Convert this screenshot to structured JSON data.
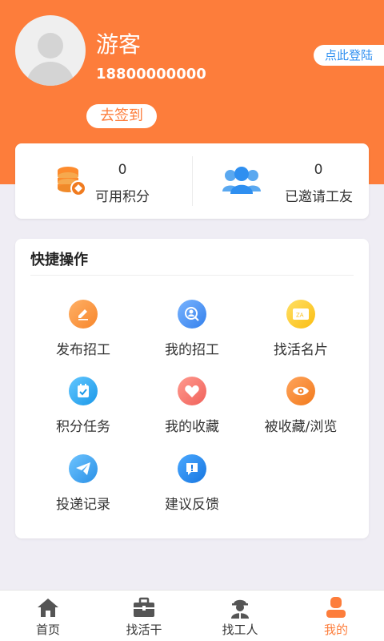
{
  "profile": {
    "username": "游客",
    "phone": "18800000000",
    "login_label": "点此登陆",
    "signin_label": "去签到"
  },
  "stats": [
    {
      "value": "0",
      "label": "可用积分",
      "icon": "coins-icon"
    },
    {
      "value": "0",
      "label": "已邀请工友",
      "icon": "users-icon"
    }
  ],
  "quick": {
    "title": "快捷操作",
    "items": [
      {
        "label": "发布招工",
        "icon": "edit-icon"
      },
      {
        "label": "我的招工",
        "icon": "user-search-icon"
      },
      {
        "label": "找活名片",
        "icon": "card-icon"
      },
      {
        "label": "积分任务",
        "icon": "task-icon"
      },
      {
        "label": "我的收藏",
        "icon": "heart-icon"
      },
      {
        "label": "被收藏/浏览",
        "icon": "eye-icon"
      },
      {
        "label": "投递记录",
        "icon": "send-icon"
      },
      {
        "label": "建议反馈",
        "icon": "feedback-icon"
      }
    ]
  },
  "tabbar": {
    "items": [
      {
        "label": "首页",
        "icon": "home-icon",
        "active": false
      },
      {
        "label": "找活干",
        "icon": "briefcase-icon",
        "active": false
      },
      {
        "label": "找工人",
        "icon": "worker-icon",
        "active": false
      },
      {
        "label": "我的",
        "icon": "profile-icon",
        "active": true
      }
    ]
  },
  "colors": {
    "brand": "#fd7d3b",
    "link": "#2f8ff0",
    "background": "#efedf4"
  }
}
